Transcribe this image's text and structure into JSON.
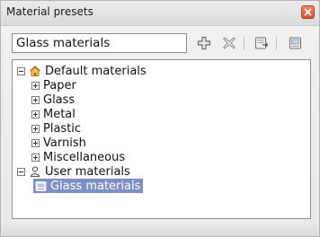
{
  "window": {
    "title": "Material presets"
  },
  "toolbar": {
    "preset_name_value": "Glass materials",
    "icons": [
      "add-icon",
      "delete-icon",
      "import-icon",
      "export-icon"
    ]
  },
  "tree": {
    "default_group": {
      "label": "Default materials",
      "icon": "home-icon",
      "expanded": true,
      "children": [
        "Paper",
        "Glass",
        "Metal",
        "Plastic",
        "Varnish",
        "Miscellaneous"
      ]
    },
    "user_group": {
      "label": "User materials",
      "icon": "user-icon",
      "expanded": true,
      "children": [
        {
          "label": "Glass materials",
          "icon": "preset-icon",
          "selected": true
        }
      ]
    }
  },
  "colors": {
    "selection": "#7d8fc4",
    "close_button": "#d7532f"
  }
}
